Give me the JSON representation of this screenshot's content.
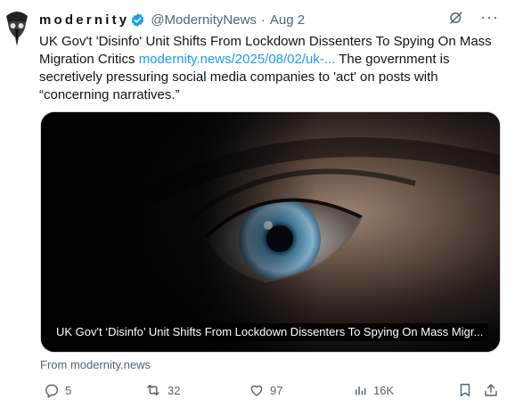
{
  "tweet": {
    "display_name": "modernity",
    "handle": "@ModernityNews",
    "separator": "·",
    "date": "Aug 2",
    "text_before_link": "UK Gov't 'Disinfo' Unit Shifts From Lockdown Dissenters To Spying On Mass Migration Critics ",
    "link_text": "modernity.news/2025/08/02/uk-...",
    "text_after_link": " The government is secretively pressuring social media companies to 'act' on posts with “concerning narratives.”",
    "card_title": "UK Gov't ‘Disinfo’ Unit Shifts From Lockdown Dissenters To Spying On Mass Migr...",
    "source": "From modernity.news",
    "more_label": "···"
  },
  "actions": {
    "replies": "5",
    "reposts": "32",
    "likes": "97",
    "views": "16K"
  },
  "colors": {
    "accent": "#1d9bf0",
    "muted": "#536471",
    "text": "#0f1419"
  },
  "icons": {
    "verified": "verified-badge-icon",
    "grok": "grok-icon",
    "more": "more-icon",
    "reply": "reply-icon",
    "repost": "repost-icon",
    "like": "heart-icon",
    "views": "views-icon",
    "bookmark": "bookmark-icon",
    "share": "share-icon"
  }
}
